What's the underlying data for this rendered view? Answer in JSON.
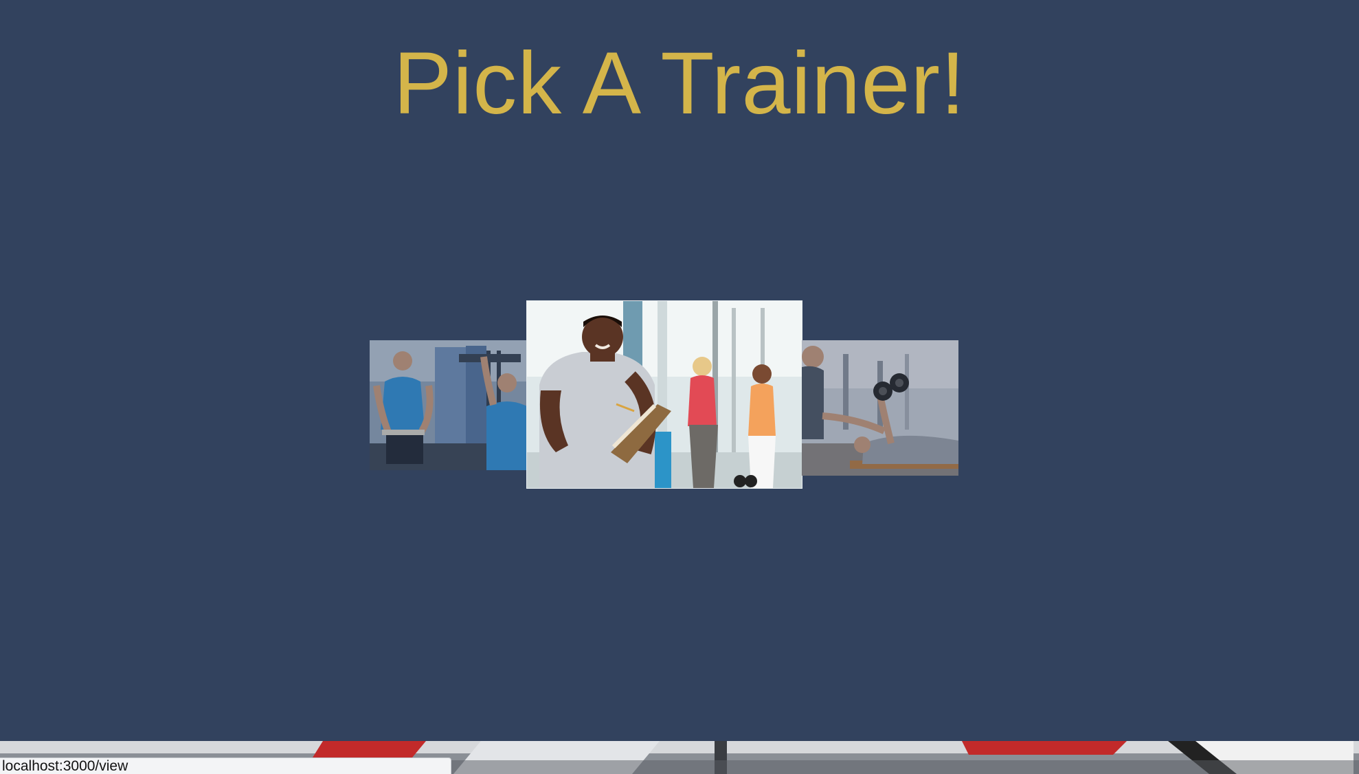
{
  "page": {
    "title": "Pick A Trainer!"
  },
  "trainers": [
    {
      "position": "left",
      "photo": "trainer-with-clipboard-at-cable-machine"
    },
    {
      "position": "center",
      "photo": "smiling-trainer-with-clipboard-in-gym",
      "selected": true
    },
    {
      "position": "right",
      "photo": "trainer-spotting-dumbbell-bench-press"
    }
  ],
  "status_bar": {
    "url": "localhost:3000/view"
  },
  "colors": {
    "background": "#32425e",
    "title": "#d4b54a",
    "status_bar_bg": "#f3f4f6"
  }
}
